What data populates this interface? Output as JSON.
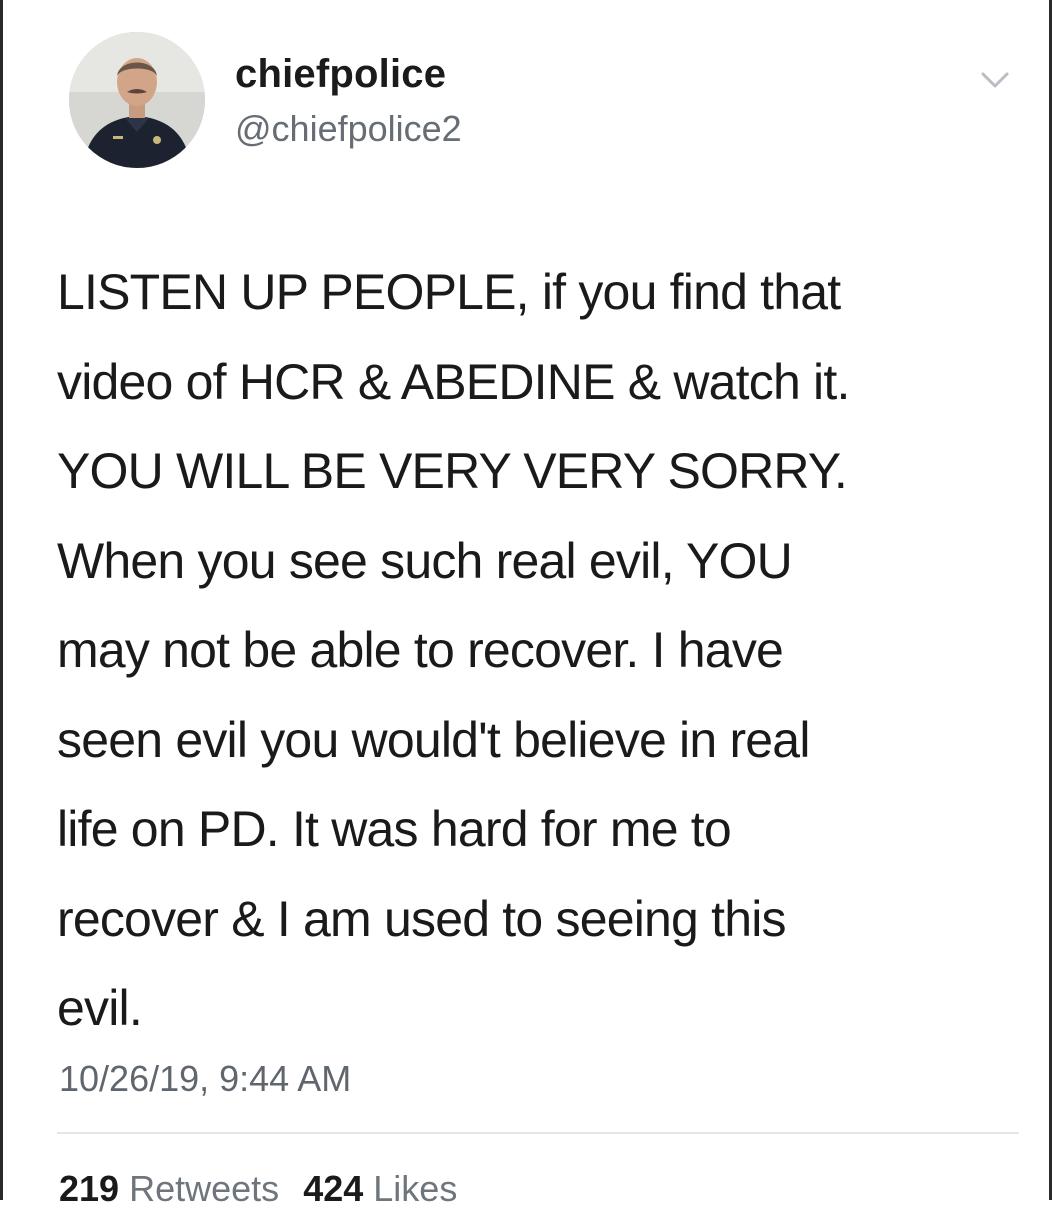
{
  "tweet": {
    "author": {
      "display_name": "chiefpolice",
      "handle": "@chiefpolice2"
    },
    "text": "LISTEN UP PEOPLE, if you find that\nvideo of HCR & ABEDINE & watch it.\nYOU WILL BE VERY VERY SORRY.\nWhen you see such real evil, YOU\nmay not be able to recover. I have\nseen evil you would't believe in real\nlife on PD. It was hard for me to\nrecover & I am used to seeing this\nevil.",
    "timestamp": "10/26/19, 9:44 AM",
    "stats": {
      "retweets_count": "219",
      "retweets_label": "Retweets",
      "likes_count": "424",
      "likes_label": "Likes"
    },
    "icons": {
      "menu": "chevron-down-icon"
    }
  }
}
